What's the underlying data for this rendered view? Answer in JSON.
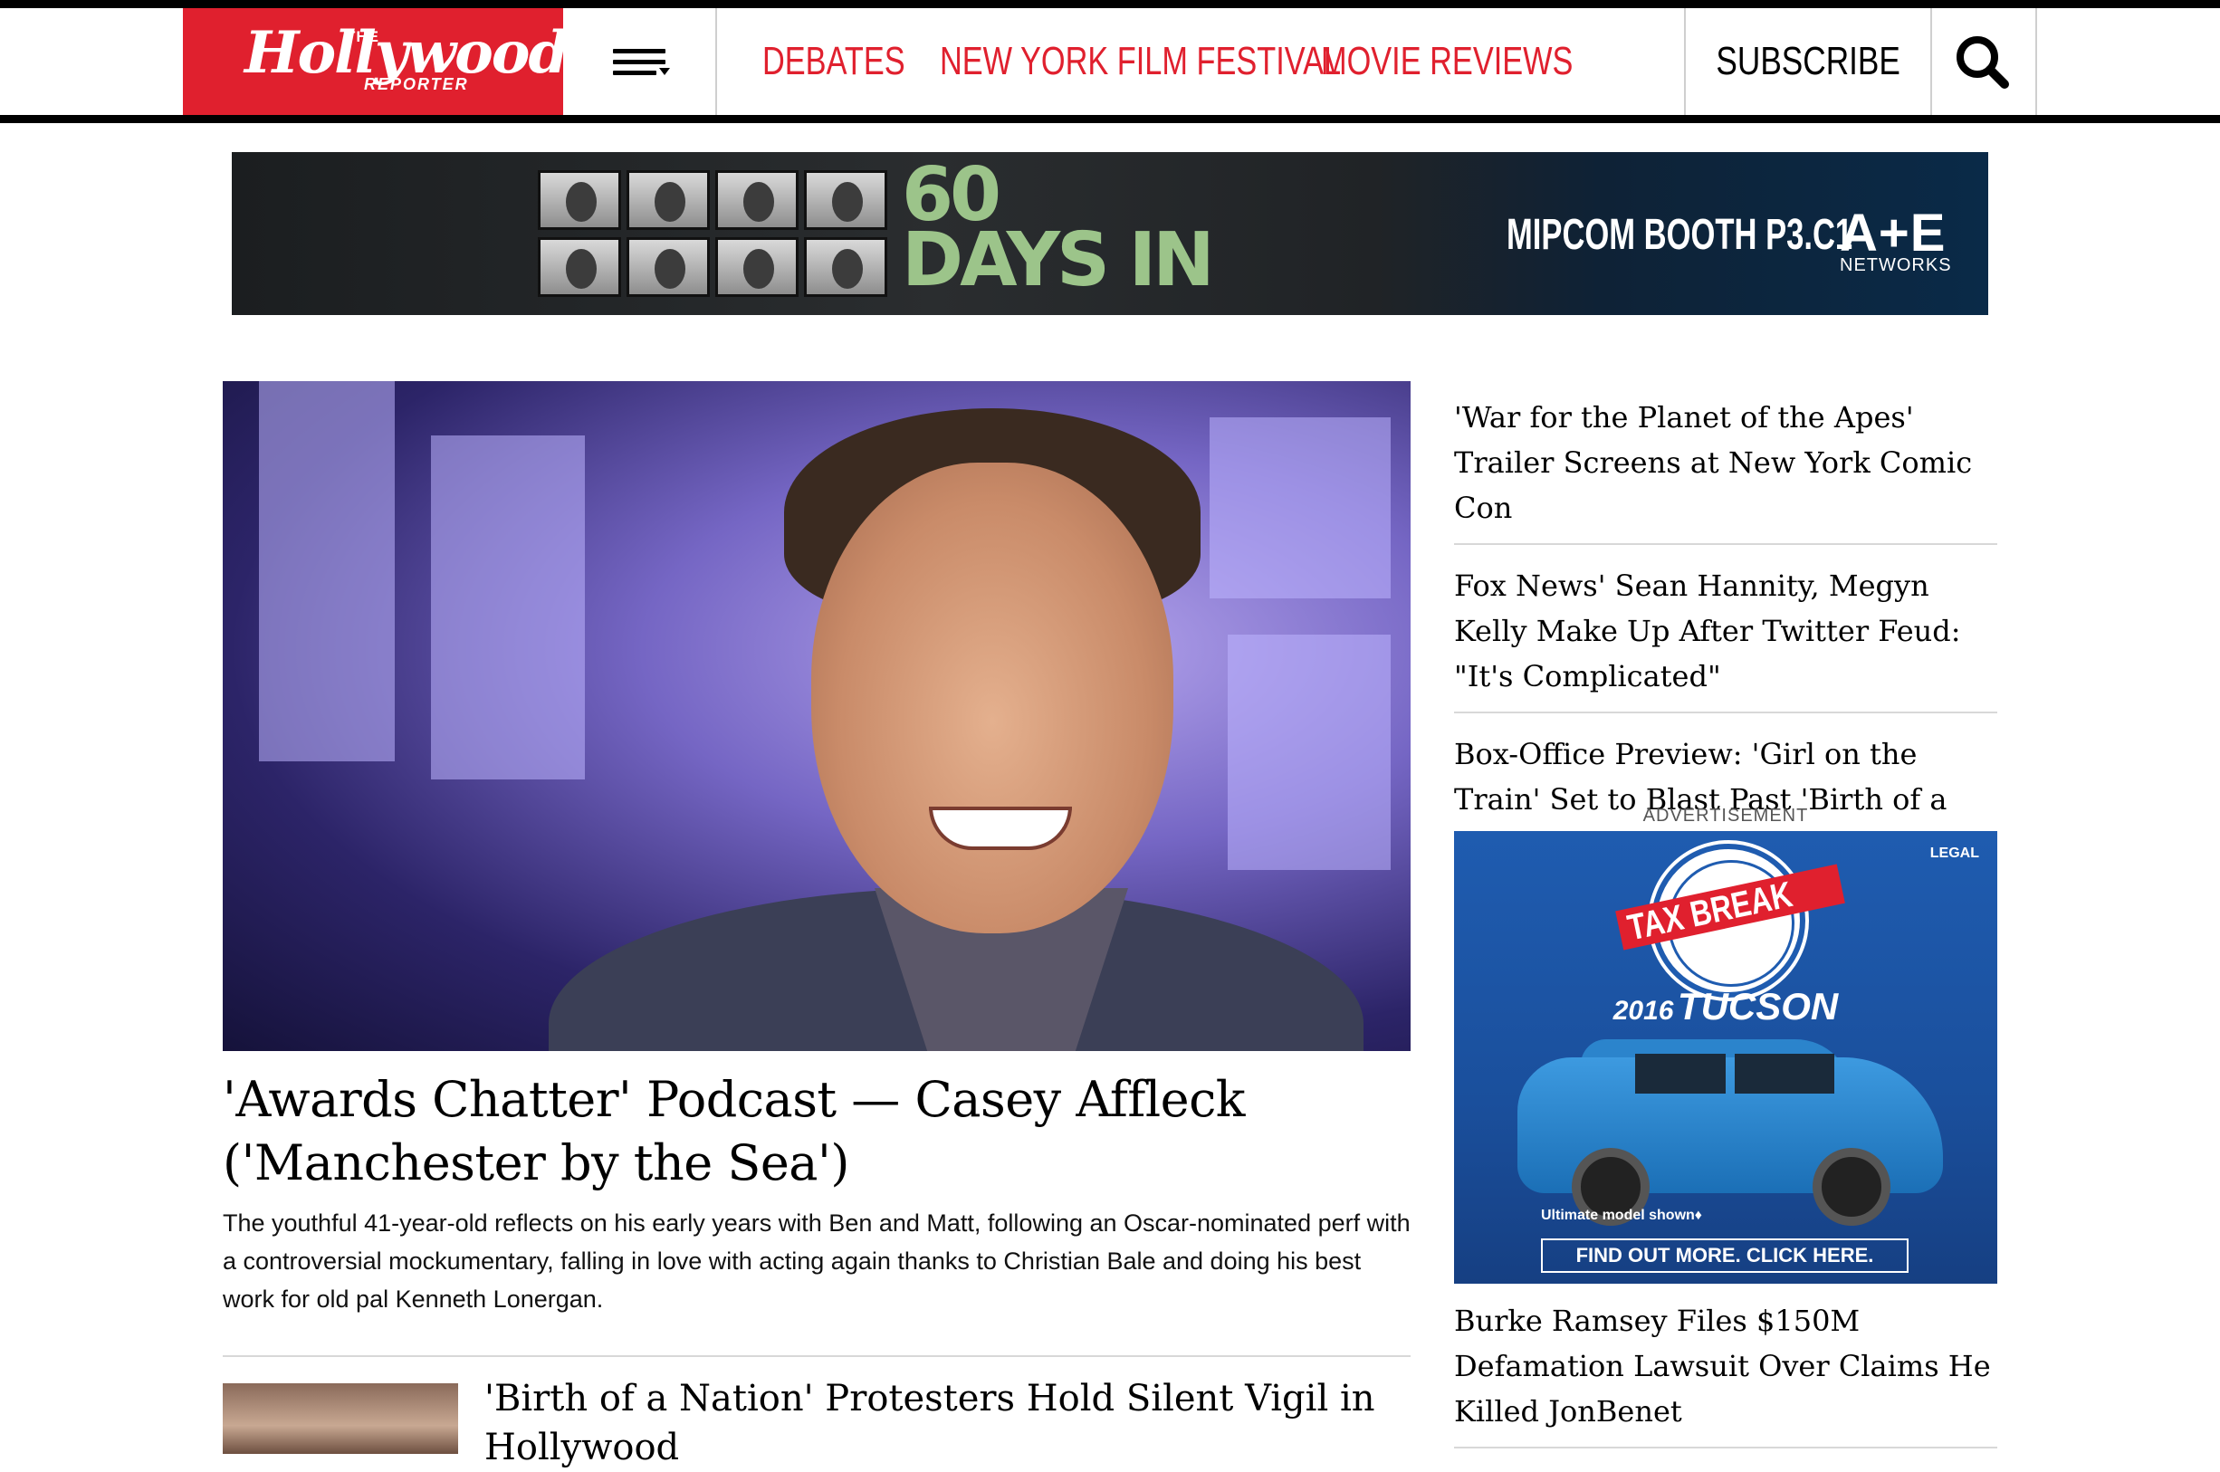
{
  "header": {
    "logo_the": "THE",
    "logo_main": "Hollywood",
    "logo_sub": "REPORTER",
    "brand_color": "#e0202e",
    "nav_items": [
      "DEBATES",
      "NEW YORK FILM FESTIVAL",
      "MOVIE REVIEWS"
    ],
    "subscribe_label": "SUBSCRIBE"
  },
  "banner_ad": {
    "show_title_line1": "60",
    "show_title_line2": "DAYS IN",
    "booth_text": "MIPCOM BOOTH P3.C1",
    "network_logo": "A+E",
    "network_sub": "NETWORKS"
  },
  "hero": {
    "title": "'Awards Chatter' Podcast — Casey Affleck ('Manchester by the Sea')",
    "description": "The youthful 41-year-old reflects on his early years with Ben and Matt, following an Oscar-nominated perf with a controversial mockumentary, falling in love with acting again thanks to Christian Bale and doing his best work for old pal Kenneth Lonergan."
  },
  "story2": {
    "title": "'Birth of a Nation' Protesters Hold Silent Vigil in Hollywood"
  },
  "sidebar": {
    "headlines": [
      "'War for the Planet of the Apes' Trailer Screens at New York Comic Con",
      "Fox News' Sean Hannity, Megyn Kelly Make Up After Twitter Feud: \"It's Complicated\"",
      "Box-Office Preview: 'Girl on the Train' Set to Blast Past 'Birth of a Nation'"
    ],
    "ad_label": "ADVERTISEMENT",
    "ad": {
      "legal": "LEGAL",
      "tax_break": "TAX BREAK",
      "model_year": "2016",
      "model_name": "TUCSON",
      "shown_note": "Ultimate model shown♦",
      "cta": "FIND OUT MORE. CLICK HERE."
    },
    "headlines_after_ad": [
      "Burke Ramsey Files $150M Defamation Lawsuit Over Claims He Killed JonBenet"
    ]
  }
}
